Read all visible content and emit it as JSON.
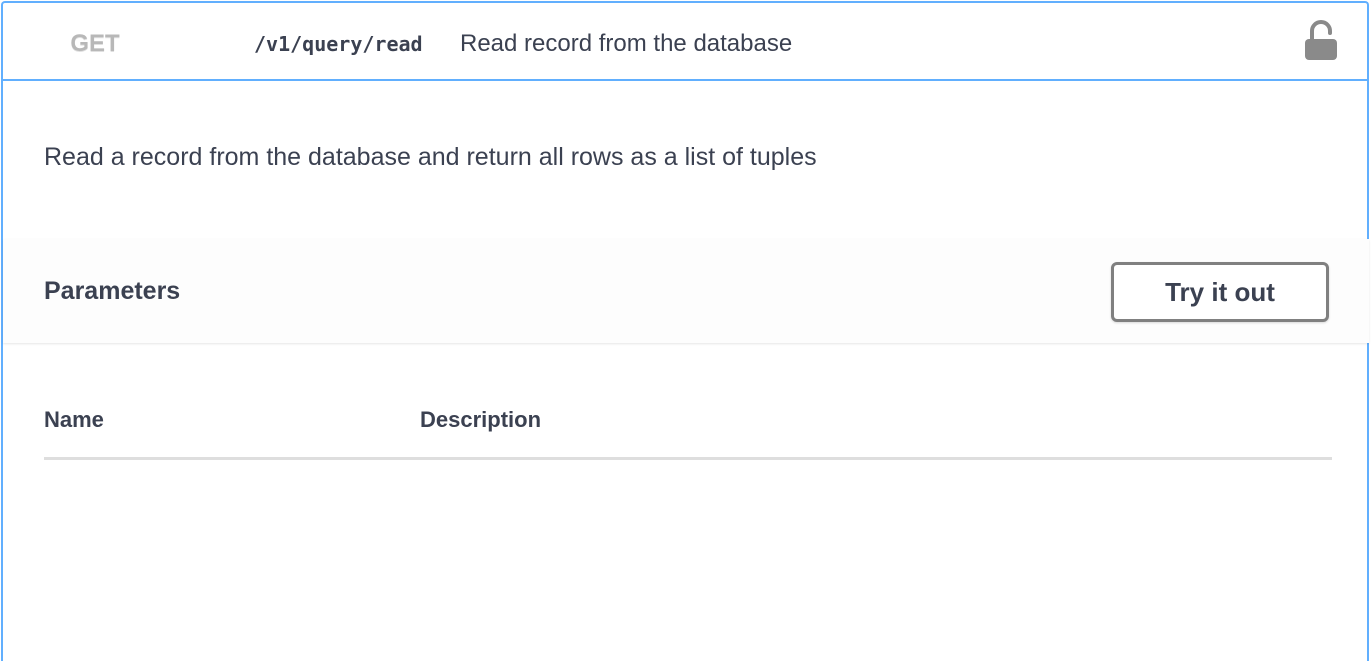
{
  "operation": {
    "method": "GET",
    "path": "/v1/query/read",
    "summary": "Read record from the database",
    "description": "Read a record from the database and return all rows as a list of tuples",
    "lock_icon": "lock-open-icon",
    "accent_color": "#61affe"
  },
  "parameters": {
    "title": "Parameters",
    "try_button_label": "Try it out",
    "columns": [
      "Name",
      "Description"
    ],
    "rows": []
  }
}
